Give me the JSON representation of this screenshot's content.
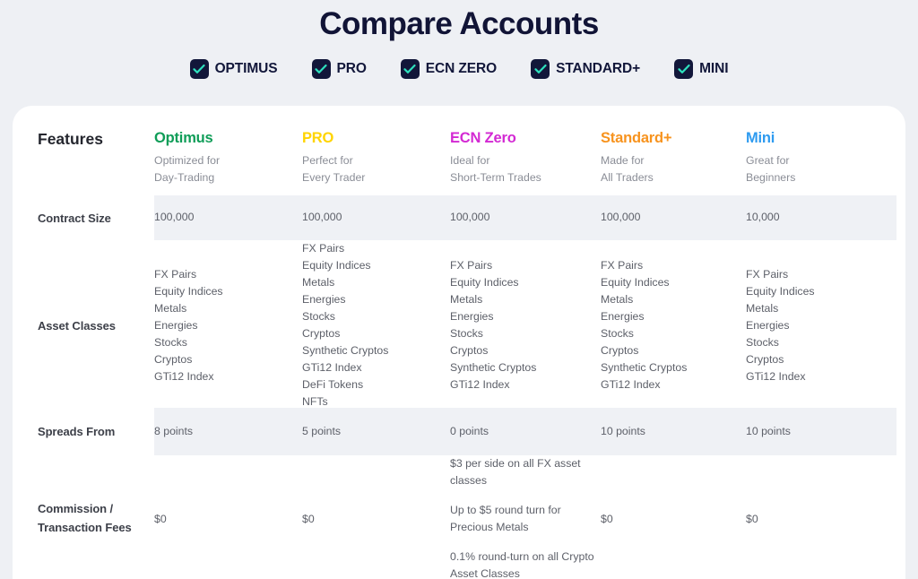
{
  "page": {
    "title": "Compare Accounts",
    "background_color": "#eef0f4",
    "card_color": "#ffffff",
    "stripe_color": "#eff1f5"
  },
  "legend": {
    "checkbox_color": "#12173a",
    "check_color": "#2ee0bd",
    "items": [
      {
        "label": "OPTIMUS",
        "checked": true,
        "icon": "checkbox-checked-icon"
      },
      {
        "label": "PRO",
        "checked": true,
        "icon": "checkbox-checked-icon"
      },
      {
        "label": "ECN ZERO",
        "checked": true,
        "icon": "checkbox-checked-icon"
      },
      {
        "label": "STANDARD+",
        "checked": true,
        "icon": "checkbox-checked-icon"
      },
      {
        "label": "MINI",
        "checked": true,
        "icon": "checkbox-checked-icon"
      }
    ]
  },
  "table": {
    "corner_label": "Features",
    "columns": [
      {
        "name": "Optimus",
        "color": "#0f9d58",
        "subtitle_line1": "Optimized for",
        "subtitle_line2": "Day-Trading"
      },
      {
        "name": "PRO",
        "color": "#ffd400",
        "subtitle_line1": "Perfect for",
        "subtitle_line2": "Every Trader"
      },
      {
        "name": "ECN Zero",
        "color": "#d329d3",
        "subtitle_line1": "Ideal for",
        "subtitle_line2": "Short-Term Trades"
      },
      {
        "name": "Standard+",
        "color": "#f7931e",
        "subtitle_line1": "Made for",
        "subtitle_line2": "All Traders"
      },
      {
        "name": "Mini",
        "color": "#2e9bf0",
        "subtitle_line1": "Great for",
        "subtitle_line2": "Beginners"
      }
    ],
    "rows": [
      {
        "label": "Contract Size",
        "striped": true,
        "cells": [
          "100,000",
          "100,000",
          "100,000",
          "100,000",
          "10,000"
        ]
      },
      {
        "label": "Asset Classes",
        "striped": false,
        "lists": [
          [
            "FX Pairs",
            "Equity Indices",
            "Metals",
            "Energies",
            "Stocks",
            "Cryptos",
            "GTi12 Index"
          ],
          [
            "FX Pairs",
            "Equity Indices",
            "Metals",
            "Energies",
            "Stocks",
            "Cryptos",
            "Synthetic Cryptos",
            "GTi12 Index",
            "DeFi Tokens",
            "NFTs"
          ],
          [
            "FX Pairs",
            "Equity Indices",
            "Metals",
            "Energies",
            "Stocks",
            "Cryptos",
            "Synthetic Cryptos",
            "GTi12 Index"
          ],
          [
            "FX Pairs",
            "Equity Indices",
            "Metals",
            "Energies",
            "Stocks",
            "Cryptos",
            "Synthetic Cryptos",
            "GTi12 Index"
          ],
          [
            "FX Pairs",
            "Equity Indices",
            "Metals",
            "Energies",
            "Stocks",
            "Cryptos",
            "GTi12 Index"
          ]
        ]
      },
      {
        "label": "Spreads From",
        "striped": true,
        "cells": [
          "8 points",
          "5 points",
          "0 points",
          "10 points",
          "10 points"
        ]
      },
      {
        "label_line1": "Commission /",
        "label_line2": "Transaction Fees",
        "striped": false,
        "cells": [
          "$0",
          "$0",
          null,
          "$0",
          "$0"
        ],
        "paragraphs_col3": [
          "$3 per side on all FX asset classes",
          "Up to $5 round turn for Precious Metals",
          "0.1% round-turn on all Crypto Asset Classes"
        ]
      }
    ]
  }
}
